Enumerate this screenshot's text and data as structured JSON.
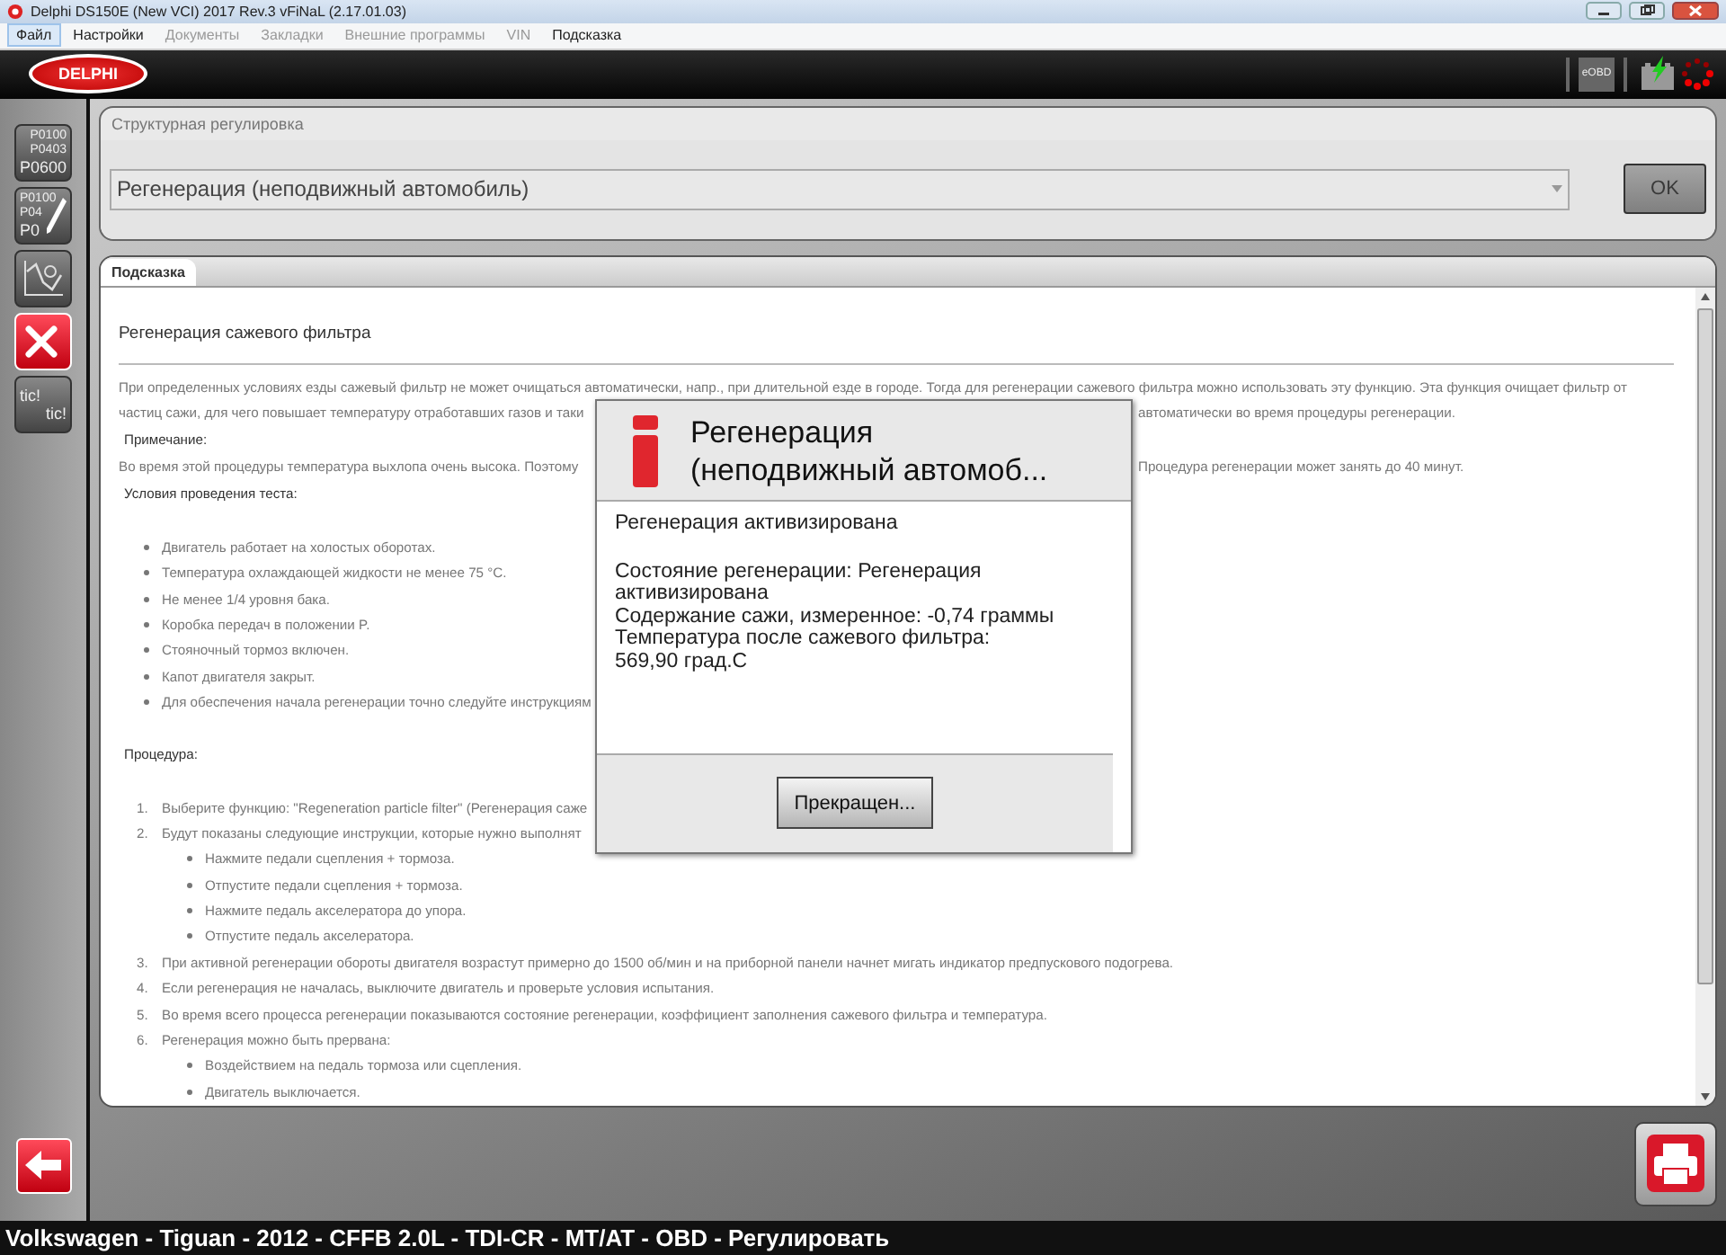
{
  "window": {
    "title": "Delphi DS150E (New VCI) 2017 Rev.3 vFiNaL (2.17.01.03)"
  },
  "menu": [
    {
      "label": "Файл",
      "selected": true,
      "disabled": false
    },
    {
      "label": "Настройки",
      "selected": false,
      "disabled": false
    },
    {
      "label": "Документы",
      "selected": false,
      "disabled": true
    },
    {
      "label": "Закладки",
      "selected": false,
      "disabled": true
    },
    {
      "label": "Внешние программы",
      "selected": false,
      "disabled": true
    },
    {
      "label": "VIN",
      "selected": false,
      "disabled": true
    },
    {
      "label": "Подсказка",
      "selected": false,
      "disabled": false
    }
  ],
  "header": {
    "logo": "DELPHI",
    "status_icons": [
      {
        "kind": "eobd",
        "label": "eOBD"
      },
      {
        "kind": "battery"
      },
      {
        "kind": "spinner"
      }
    ]
  },
  "sidebar": [
    {
      "kind": "codes",
      "lines": [
        "P0100",
        "P0403",
        "P0600"
      ],
      "selected": false
    },
    {
      "kind": "codes-edit",
      "lines": [
        "P0100",
        "P04",
        "P0"
      ],
      "selected": false
    },
    {
      "kind": "graph",
      "selected": false
    },
    {
      "kind": "adjust",
      "selected": true
    },
    {
      "kind": "tic",
      "lines": [
        "tic!",
        "tic!"
      ],
      "selected": false
    }
  ],
  "adjustment_panel": {
    "title": "Структурная регулировка",
    "dropdown": {
      "value": "Регенерация (неподвижный автомобиль)"
    },
    "ok_button": {
      "label": "OK",
      "disabled": true
    }
  },
  "hint_panel": {
    "tab": "Подсказка",
    "heading": "Регенерация сажевого фильтра",
    "blocks": [
      {
        "kind": "paragraph",
        "lines": [
          {
            "text": "При определенных условиях езды сажевый фильтр не может очищаться автоматически, напр., при длительной езде в городе. Тогда для регенерации сажевого фильтра можно использовать эту функцию. Эта функция очищает фильтр от"
          },
          {
            "text": "частиц сажи, для чего повышает температуру отработавших газов и таки",
            "right": "автоматически во время процедуры регенерации."
          }
        ]
      },
      {
        "kind": "label",
        "text": "Примечание:"
      },
      {
        "kind": "paragraph",
        "lines": [
          {
            "text": "Во время этой процедуры температура выхлопа очень высока. Поэтому",
            "right": "Процедура регенерации может занять до 40 минут."
          }
        ]
      },
      {
        "kind": "label",
        "text": "Условия проведения теста:"
      },
      {
        "kind": "bullets",
        "items": [
          {
            "text": "Двигатель работает на холостых оборотах."
          },
          {
            "text": "Температура охлаждающей жидкости не менее 75 °C."
          },
          {
            "text": "Не менее 1/4 уровня бака."
          },
          {
            "text": "Коробка передач в положении P."
          },
          {
            "text": "Стояночный тормоз включен."
          },
          {
            "text": "Капот двигателя закрыт."
          },
          {
            "text": "Для обеспечения начала регенерации точно следуйте инструкциям"
          }
        ]
      },
      {
        "kind": "label",
        "text": "Процедура:"
      },
      {
        "kind": "numbered",
        "items": [
          {
            "number": "1.",
            "text": "Выберите функцию: \"Regeneration particle filter\" (Регенерация саже"
          },
          {
            "number": "2.",
            "text": "Будут показаны следующие инструкции, которые нужно выполнят",
            "children": [
              {
                "text": "Нажмите педали сцепления + тормоза."
              },
              {
                "text": "Отпустите педали сцепления + тормоза."
              },
              {
                "text": "Нажмите педаль акселератора до упора."
              },
              {
                "text": "Отпустите педаль акселератора."
              }
            ]
          },
          {
            "number": "3.",
            "text": "При активной регенерации обороты двигателя возрастут примерно до 1500 об/мин и на приборной панели начнет мигать индикатор предпускового подогрева."
          },
          {
            "number": "4.",
            "text": "Если регенерация не началась, выключите двигатель и проверьте условия испытания."
          },
          {
            "number": "5.",
            "text": "Во время всего процесса регенерации показываются состояние регенерации, коэффициент заполнения сажевого фильтра и температура."
          },
          {
            "number": "6.",
            "text": "Регенерация можно быть прервана:",
            "children": [
              {
                "text": "Воздействием на педаль тормоза или сцепления."
              },
              {
                "text": "Двигатель выключается."
              }
            ]
          }
        ]
      }
    ]
  },
  "dialog": {
    "title": "Регенерация\n(неподвижный автомоб...",
    "status": "Регенерация активизирована",
    "details": [
      "Состояние регенерации: Регенерация активизирована",
      "Содержание сажи, измеренное: -0,74 граммы",
      "Температура после сажевого фильтра: 569,90 град.С"
    ],
    "button": "Прекращен..."
  },
  "status_bar": "Volkswagen - Tiguan - 2012 - CFFB 2.0L - TDI-CR - MT/AT - OBD - Регулировать"
}
